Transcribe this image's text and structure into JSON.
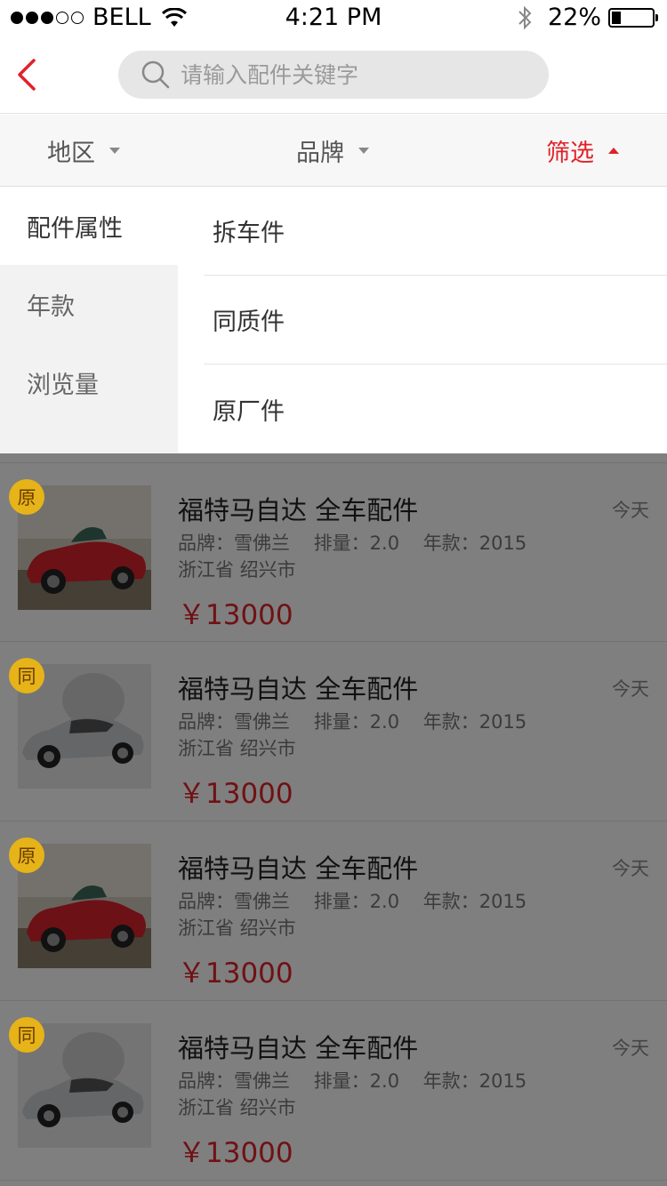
{
  "status_bar": {
    "carrier": "BELL",
    "time": "4:21 PM",
    "battery": "22%",
    "signal_bars_filled": 3,
    "signal_bars_total": 5,
    "battery_level": 0.22
  },
  "nav": {
    "back_icon": "chevron-left-icon",
    "search_placeholder": "请输入配件关键字",
    "accent_color": "#e0222a"
  },
  "filters": [
    {
      "label": "地区",
      "active": false
    },
    {
      "label": "品牌",
      "active": false
    },
    {
      "label": "筛选",
      "active": true
    }
  ],
  "dropdown": {
    "categories": [
      {
        "label": "配件属性",
        "selected": true
      },
      {
        "label": "年款",
        "selected": false
      },
      {
        "label": "浏览量",
        "selected": false
      }
    ],
    "options": [
      "拆车件",
      "同质件",
      "原厂件"
    ]
  },
  "listings": [
    {
      "badge": "原",
      "title": "福特马自达 全车配件",
      "date": "今天",
      "brand": "品牌：雪佛兰",
      "displacement": "排量：2.0",
      "year": "年款：2015",
      "location": "浙江省 绍兴市",
      "price": "￥13000",
      "image": "red-convertible"
    },
    {
      "badge": "同",
      "title": "福特马自达 全车配件",
      "date": "今天",
      "brand": "品牌：雪佛兰",
      "displacement": "排量：2.0",
      "year": "年款：2015",
      "location": "浙江省 绍兴市",
      "price": "￥13000",
      "image": "silver-sedan"
    },
    {
      "badge": "原",
      "title": "福特马自达 全车配件",
      "date": "今天",
      "brand": "品牌：雪佛兰",
      "displacement": "排量：2.0",
      "year": "年款：2015",
      "location": "浙江省 绍兴市",
      "price": "￥13000",
      "image": "red-convertible"
    },
    {
      "badge": "同",
      "title": "福特马自达 全车配件",
      "date": "今天",
      "brand": "品牌：雪佛兰",
      "displacement": "排量：2.0",
      "year": "年款：2015",
      "location": "浙江省 绍兴市",
      "price": "￥13000",
      "image": "silver-sedan"
    }
  ]
}
